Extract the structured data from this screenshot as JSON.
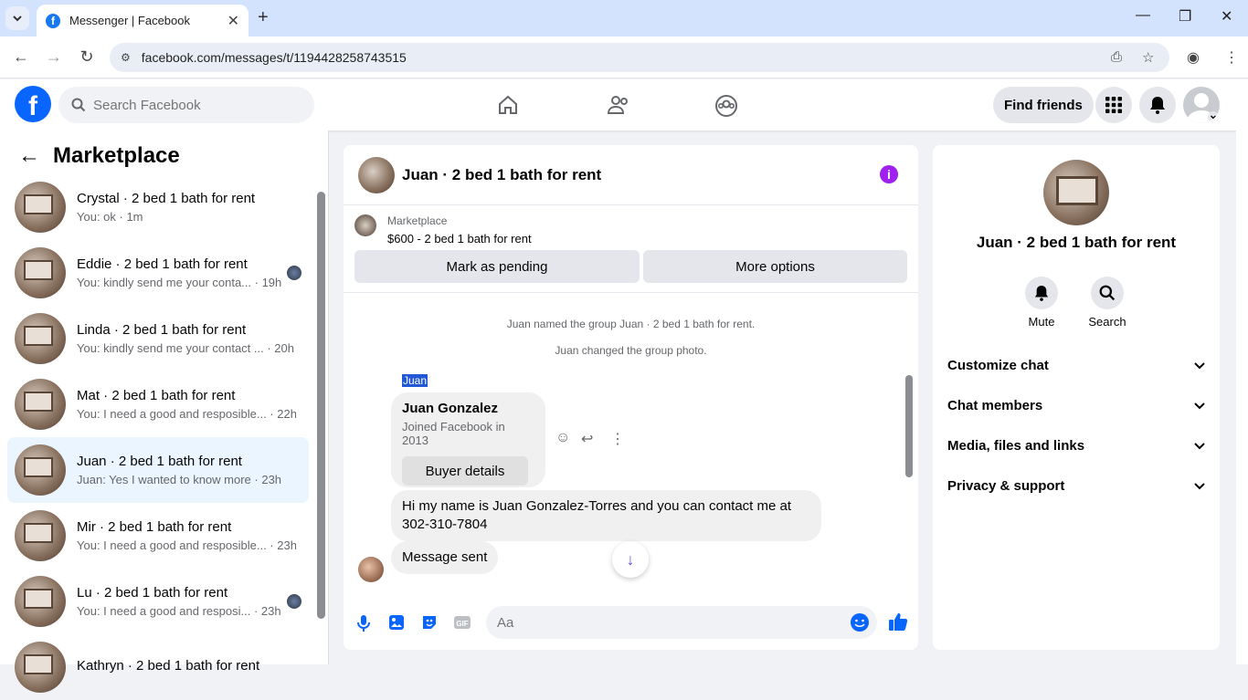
{
  "browser": {
    "tab_title": "Messenger | Facebook",
    "url": "facebook.com/messages/t/1194428258743515"
  },
  "fb_header": {
    "search_placeholder": "Search Facebook",
    "find_friends": "Find friends"
  },
  "sidebar": {
    "title": "Marketplace",
    "conversations": [
      {
        "name": "Crystal · 2 bed 1 bath for rent",
        "preview": "You: ok · 1m",
        "active": false,
        "badge": false
      },
      {
        "name": "Eddie · 2 bed 1 bath for rent",
        "preview": "You: kindly send me your conta... · 19h",
        "active": false,
        "badge": true
      },
      {
        "name": "Linda · 2 bed 1 bath for rent",
        "preview": "You: kindly send me your contact ... · 20h",
        "active": false,
        "badge": false
      },
      {
        "name": "Mat · 2 bed 1 bath for rent",
        "preview": "You: I need a good and resposible... · 22h",
        "active": false,
        "badge": false
      },
      {
        "name": "Juan · 2 bed 1 bath for rent",
        "preview": "Juan: Yes I wanted to know more · 23h",
        "active": true,
        "badge": false
      },
      {
        "name": "Mir · 2 bed 1 bath for rent",
        "preview": "You: I need a good and resposible... · 23h",
        "active": false,
        "badge": false
      },
      {
        "name": "Lu · 2 bed 1 bath for rent",
        "preview": "You: I need a good and resposi... · 23h",
        "active": false,
        "badge": true
      },
      {
        "name": "Kathryn · 2 bed 1 bath for rent",
        "preview": "",
        "active": false,
        "badge": false
      }
    ]
  },
  "chat": {
    "title": "Juan · 2 bed 1 bath for rent",
    "marketplace_label": "Marketplace",
    "listing": "$600 - 2 bed 1 bath for rent",
    "mark_pending": "Mark as pending",
    "more_options": "More options",
    "system_messages": [
      "Juan named the group Juan · 2 bed 1 bath for rent.",
      "Juan changed the group photo."
    ],
    "sender_label": "Juan",
    "card": {
      "name": "Juan Gonzalez",
      "sub": "Joined Facebook in 2013",
      "button": "Buyer details"
    },
    "message1": "Hi my name is Juan Gonzalez-Torres and you can contact me at 302-310-7804",
    "message2": "Message sent",
    "compose_placeholder": "Aa"
  },
  "right_panel": {
    "name": "Juan · 2 bed 1 bath for rent",
    "mute": "Mute",
    "search": "Search",
    "sections": [
      "Customize chat",
      "Chat members",
      "Media, files and links",
      "Privacy & support"
    ]
  },
  "colors": {
    "fb_blue": "#0866ff",
    "messenger_purple": "#a020f0",
    "active_bg": "#ebf5ff"
  }
}
